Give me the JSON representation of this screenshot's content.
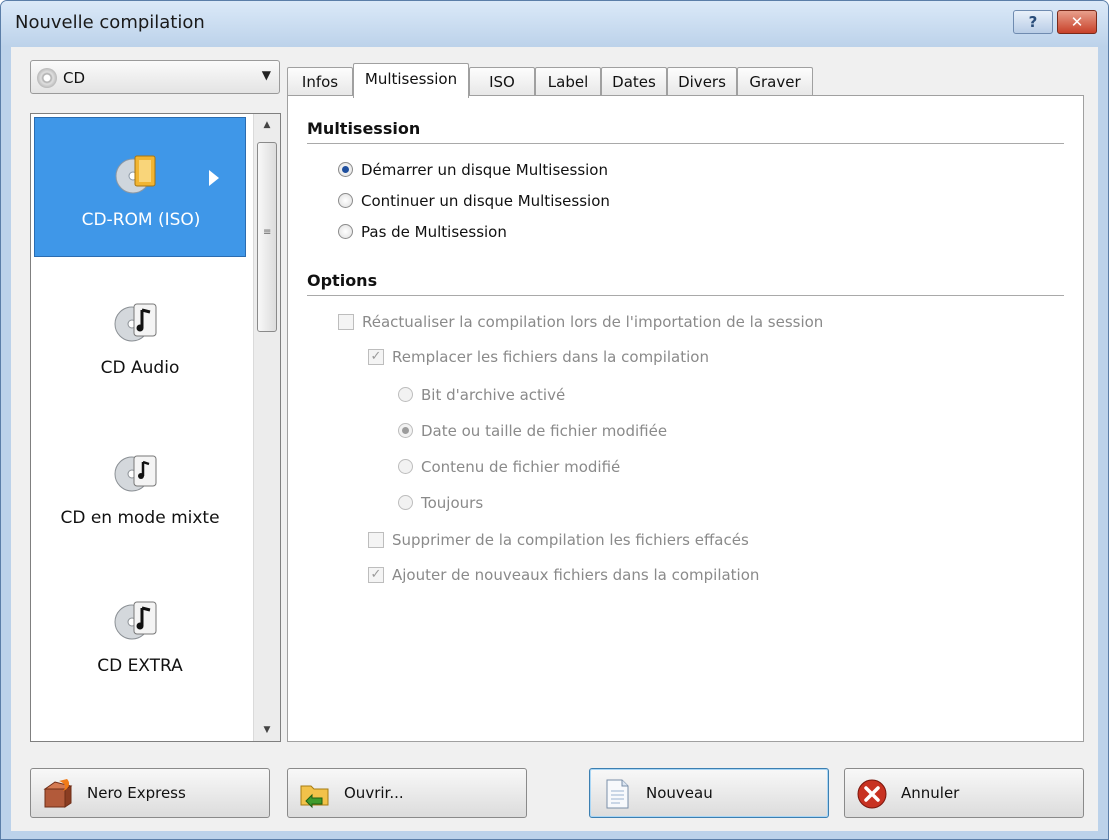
{
  "window": {
    "title": "Nouvelle compilation",
    "help_label": "?",
    "close_label": "✕"
  },
  "media_select": {
    "value": "CD"
  },
  "compilations": [
    {
      "label": "CD-ROM (ISO)",
      "icon": "data-disc-icon",
      "selected": true
    },
    {
      "label": "CD Audio",
      "icon": "audio-disc-icon",
      "selected": false
    },
    {
      "label": "CD en mode mixte",
      "icon": "mixed-disc-icon",
      "selected": false
    },
    {
      "label": "CD EXTRA",
      "icon": "extra-disc-icon",
      "selected": false
    }
  ],
  "tabs": [
    "Infos",
    "Multisession",
    "ISO",
    "Label",
    "Dates",
    "Divers",
    "Graver"
  ],
  "active_tab": "Multisession",
  "multisession": {
    "heading": "Multisession",
    "options": [
      "Démarrer un disque Multisession",
      "Continuer un disque Multisession",
      "Pas de Multisession"
    ],
    "selected_index": 0
  },
  "options": {
    "heading": "Options",
    "refresh_label": "Réactualiser la compilation lors de l'importation de la session",
    "replace_label": "Remplacer les fichiers dans la compilation",
    "replace_modes": [
      "Bit d'archive activé",
      "Date ou taille de fichier modifiée",
      "Contenu de fichier modifié",
      "Toujours"
    ],
    "replace_selected_index": 1,
    "delete_label": "Supprimer de la compilation les fichiers effacés",
    "add_label": "Ajouter de nouveaux fichiers dans la compilation"
  },
  "buttons": {
    "nero_express": "Nero Express",
    "open": "Ouvrir...",
    "new": "Nouveau",
    "cancel": "Annuler"
  },
  "colors": {
    "selection": "#3f97e8",
    "title_bar": "#bcd2ea",
    "close": "#c8412a"
  }
}
